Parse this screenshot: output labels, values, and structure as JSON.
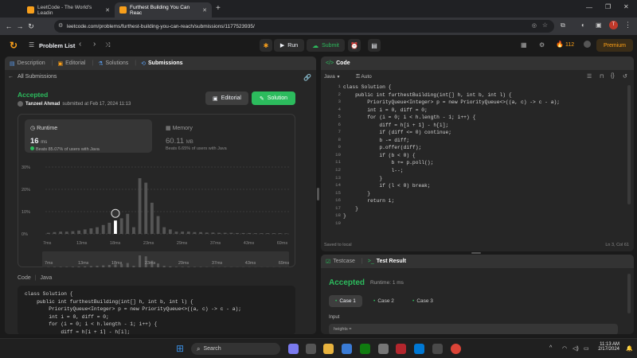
{
  "browser": {
    "tabs": [
      {
        "title": "LeetCode - The World's Leadin"
      },
      {
        "title": "Furthest Building You Can Reac"
      }
    ],
    "url": "leetcode.com/problems/furthest-building-you-can-reach/submissions/1177523935/"
  },
  "nav": {
    "problem_list": "Problem List",
    "run": "Run",
    "submit": "Submit",
    "streak": "112",
    "premium": "Premium"
  },
  "left_tabs": [
    "Description",
    "Editorial",
    "Solutions",
    "Submissions"
  ],
  "all_submissions": "All Submissions",
  "result": {
    "status": "Accepted",
    "user": "Tanzeel Ahmad",
    "submitted": "submitted at Feb 17, 2024 11:13",
    "editorial_btn": "Editorial",
    "solution_btn": "Solution"
  },
  "runtime": {
    "label": "Runtime",
    "value": "16",
    "unit": "ms",
    "beats": "Beats 85.07% of users with Java"
  },
  "memory": {
    "label": "Memory",
    "value": "60.11",
    "unit": "MB",
    "beats": "Beats 6.65% of users with Java"
  },
  "chart_data": {
    "type": "bar",
    "y_ticks": [
      "30%",
      "20%",
      "10%",
      "0%"
    ],
    "x_ticks": [
      "7ms",
      "13ms",
      "18ms",
      "23ms",
      "29ms",
      "37ms",
      "43ms",
      "69ms"
    ],
    "ylim": [
      0,
      30
    ],
    "values": [
      0.5,
      0.8,
      1,
      1,
      1.2,
      1.5,
      2,
      2.5,
      3,
      4,
      5,
      6,
      7,
      9,
      3,
      25,
      23,
      14,
      8,
      3,
      2,
      1,
      1,
      1,
      0.8,
      0.8,
      0.6,
      0.6,
      0.5,
      0.5,
      0.5,
      0.4,
      0.4,
      0.4,
      0.3,
      0.3,
      0.3,
      0.3,
      0.3,
      0.2
    ],
    "highlight_index": 11
  },
  "left_code": {
    "header_code": "Code",
    "header_lang": "Java",
    "lines": [
      "class Solution {",
      "    public int furthestBuilding(int[] h, int b, int l) {",
      "        PriorityQueue<Integer> p = new PriorityQueue<>((a, c) -> c - a);",
      "        int i = 0, diff = 0;",
      "        for (i = 0; i < h.length - 1; i++) {",
      "            diff = h[i + 1] - h[i];"
    ]
  },
  "editor": {
    "title": "Code",
    "lang": "Java",
    "mode": "Auto",
    "lines": [
      "class Solution {",
      "    public int furthestBuilding(int[] h, int b, int l) {",
      "        PriorityQueue<Integer> p = new PriorityQueue<>((a, c) -> c - a);",
      "        int i = 0, diff = 0;",
      "        for (i = 0; i < h.length - 1; i++) {",
      "            diff = h[i + 1] - h[i];",
      "            if (diff <= 0) continue;",
      "            b -= diff;",
      "            p.offer(diff);",
      "            if (b < 0) {",
      "                b += p.poll();",
      "                l--;",
      "            }",
      "            if (l < 0) break;",
      "        }",
      "        return i;",
      "    }",
      "}",
      ""
    ],
    "saved": "Saved to local",
    "cursor": "Ln 3, Col 61"
  },
  "bottom": {
    "testcase_tab": "Testcase",
    "result_tab": "Test Result",
    "status": "Accepted",
    "runtime": "Runtime: 1 ms",
    "cases": [
      "Case 1",
      "Case 2",
      "Case 3"
    ],
    "input_label": "Input",
    "input_value": "heights ="
  },
  "taskbar": {
    "search": "Search",
    "time": "11:13 AM",
    "date": "2/17/2024"
  }
}
